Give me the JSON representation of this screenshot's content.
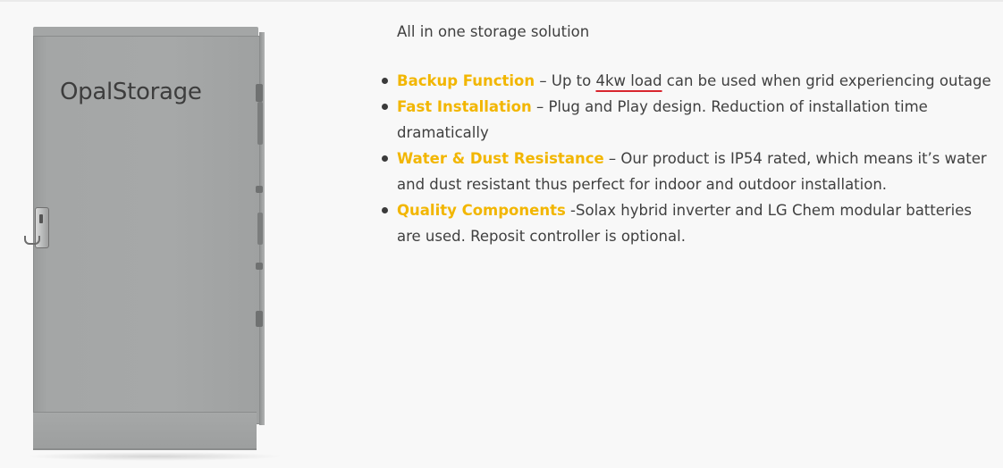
{
  "product": {
    "logo_text": "OpalStorage"
  },
  "intro": "All in one storage solution",
  "features": [
    {
      "title": "Backup Function",
      "text_before": " – Up to ",
      "highlight": "4kw load",
      "text_after": " can be used when grid experiencing outage"
    },
    {
      "title": "Fast Installation",
      "text": " – Plug and Play design. Reduction of installation time dramatically"
    },
    {
      "title": "Water & Dust Resistance",
      "text": " – Our product is IP54 rated, which means it’s water and dust resistant thus perfect for indoor and outdoor installation."
    },
    {
      "title": "Quality Components",
      "text": " -Solax hybrid inverter and LG Chem modular batteries are used. Reposit controller is optional."
    }
  ],
  "colors": {
    "accent": "#f2b600",
    "body_text": "#404040",
    "highlight_underline": "#d8262e",
    "cabinet": "#a5a7a7"
  }
}
